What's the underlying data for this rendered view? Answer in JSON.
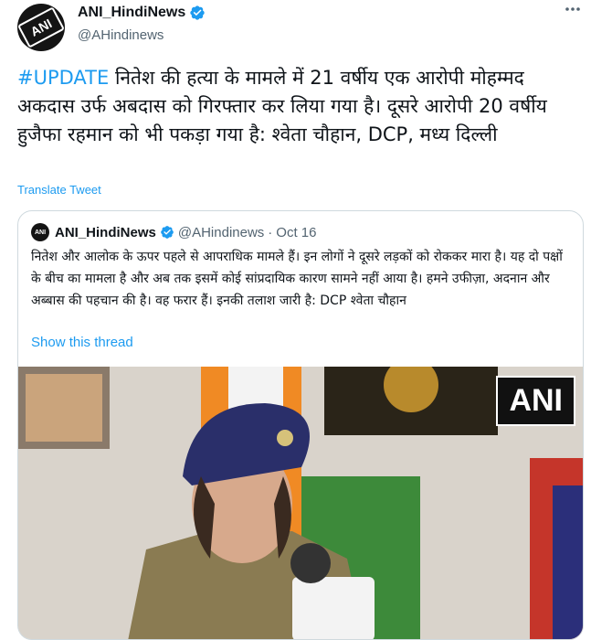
{
  "tweet": {
    "display_name": "ANI_HindiNews",
    "handle": "@AHindinews",
    "more_icon": "ellipsis-icon",
    "hashtag": "#UPDATE",
    "text": " नितेश की हत्या के मामले में 21 वर्षीय एक आरोपी मोहम्मद अकदास उर्फ अबदास को गिरफ्तार कर लिया गया है। दूसरे आरोपी 20 वर्षीय हुजैफा रहमान को भी पकड़ा गया है: श्वेता चौहान, DCP, मध्य दिल्ली",
    "translate_label": "Translate Tweet"
  },
  "quoted": {
    "display_name": "ANI_HindiNews",
    "handle": "@AHindinews",
    "separator": "·",
    "date": "Oct 16",
    "text": "नितेश और आलोक के ऊपर पहले से आपराधिक मामले हैं। इन लोगों ने दूसरे लड़कों को रोककर मारा है। यह दो पक्षों के बीच का मामला है और अब तक इसमें कोई सांप्रदायिक कारण सामने नहीं आया है। हमने उफीज़ा, अदनान और अब्बास की पहचान की है। वह फरार हैं। इनकी तलाश जारी है: DCP श्वेता चौहान",
    "show_thread_label": "Show this thread",
    "media_logo": "ANI",
    "mic_logo": "ANI"
  },
  "colors": {
    "accent": "#1d9bf0",
    "secondary_text": "#536471",
    "border": "#cfd9de",
    "verified": "#1d9bf0"
  }
}
